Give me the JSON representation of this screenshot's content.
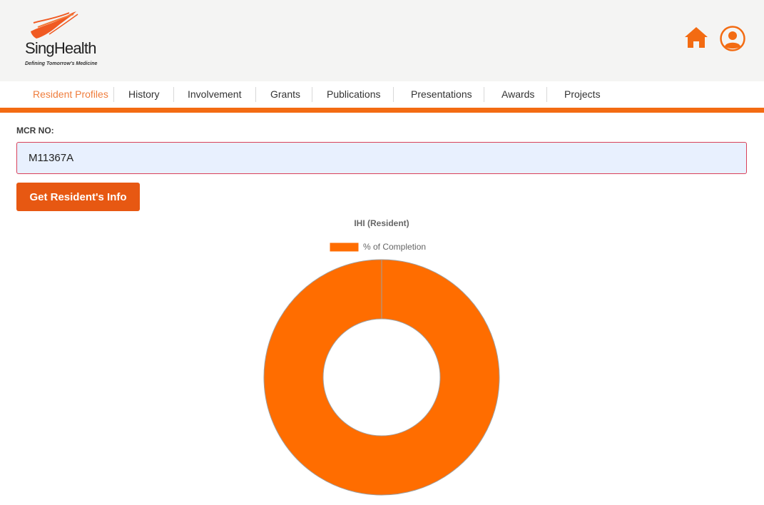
{
  "brand": {
    "name": "SingHealth",
    "tagline": "Defining Tomorrow's Medicine",
    "accent_color": "#f36b12",
    "button_color": "#e75812",
    "active_nav_color": "#ef7d3c"
  },
  "header": {
    "home_icon": "home-icon",
    "profile_icon": "user-circle-icon"
  },
  "nav": {
    "items": [
      {
        "label": "Resident Profiles",
        "active": true
      },
      {
        "label": "History"
      },
      {
        "label": "Involvement"
      },
      {
        "label": "Grants"
      },
      {
        "label": "Publications"
      },
      {
        "label": "Presentations"
      },
      {
        "label": "Awards"
      },
      {
        "label": "Projects"
      }
    ]
  },
  "form": {
    "mcr_label": "MCR NO:",
    "mcr_value": "M11367A",
    "submit_label": "Get Resident's Info"
  },
  "chart_data": {
    "type": "doughnut",
    "title": "IHI (Resident)",
    "legend": {
      "position": "top",
      "entries": [
        "% of Completion"
      ]
    },
    "series": [
      {
        "name": "% of Completion",
        "values": [
          100
        ],
        "color": "#ff6d00"
      }
    ]
  }
}
